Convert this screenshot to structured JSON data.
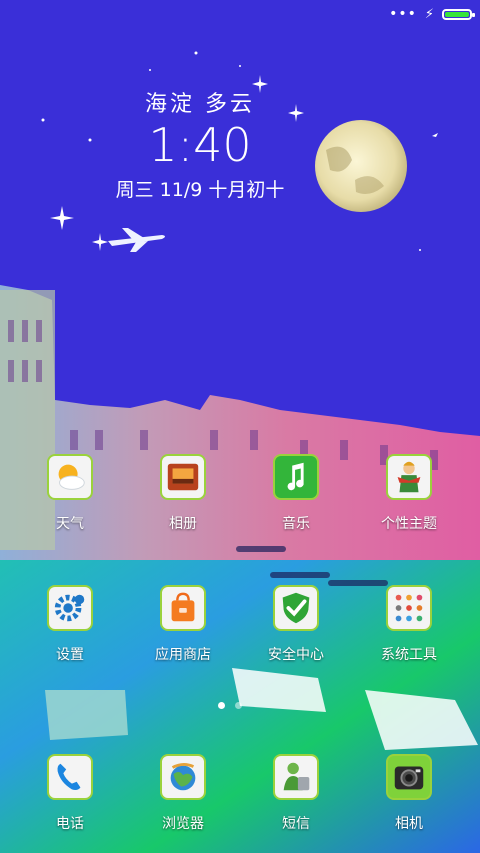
{
  "status": {
    "signal": "•••",
    "charging": "⚡",
    "battery_level": 1.0
  },
  "weather_widget": {
    "location_weather": "海淀 多云",
    "time": "1:40",
    "date": "周三 11/9 十月初十"
  },
  "apps": [
    {
      "label": "天气",
      "icon": "weather-icon"
    },
    {
      "label": "相册",
      "icon": "gallery-icon"
    },
    {
      "label": "音乐",
      "icon": "music-icon"
    },
    {
      "label": "个性主题",
      "icon": "themes-icon"
    },
    {
      "label": "设置",
      "icon": "settings-gear-icon"
    },
    {
      "label": "应用商店",
      "icon": "app-store-bag-icon"
    },
    {
      "label": "安全中心",
      "icon": "security-shield-icon"
    },
    {
      "label": "系统工具",
      "icon": "system-tools-folder-icon"
    }
  ],
  "pager": {
    "pages": 2,
    "current": 1
  },
  "dock": [
    {
      "label": "电话",
      "icon": "phone-icon"
    },
    {
      "label": "浏览器",
      "icon": "browser-globe-icon"
    },
    {
      "label": "短信",
      "icon": "messages-icon"
    },
    {
      "label": "相机",
      "icon": "camera-icon"
    }
  ],
  "colors": {
    "sky": "#3a2fd8",
    "icon_border": "#9ad23c"
  }
}
